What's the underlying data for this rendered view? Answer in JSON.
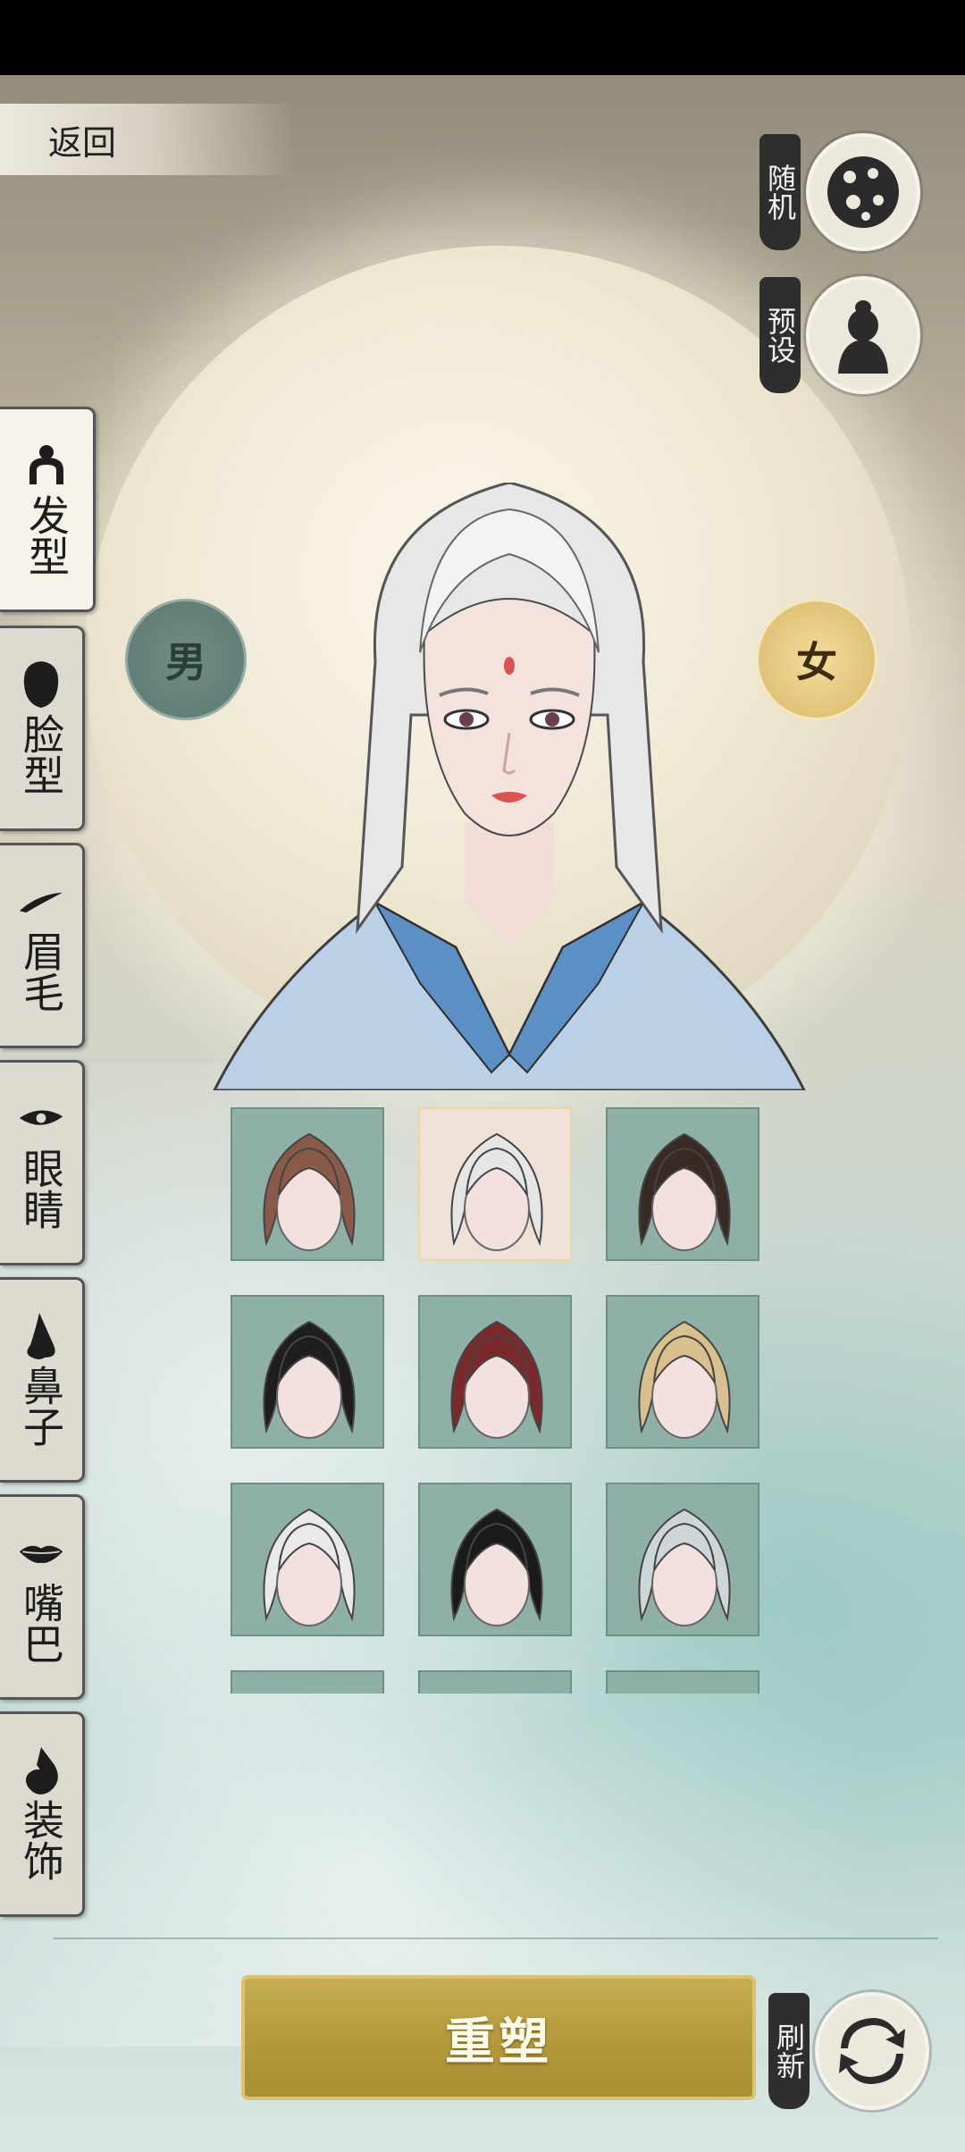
{
  "header": {
    "back_label": "返回"
  },
  "actions": {
    "random_label": "随机",
    "preset_label": "预设",
    "refresh_label": "刷新"
  },
  "gender": {
    "male_label": "男",
    "female_label": "女",
    "selected": "女"
  },
  "tabs": [
    {
      "label": "发型",
      "icon": "hair-bun-icon",
      "active": true
    },
    {
      "label": "脸型",
      "icon": "head-silhouette-icon",
      "active": false
    },
    {
      "label": "眉毛",
      "icon": "eyebrow-icon",
      "active": false
    },
    {
      "label": "眼睛",
      "icon": "eye-icon",
      "active": false
    },
    {
      "label": "鼻子",
      "icon": "nose-icon",
      "active": false
    },
    {
      "label": "嘴巴",
      "icon": "lips-icon",
      "active": false
    },
    {
      "label": "装饰",
      "icon": "ornament-icon",
      "active": false
    }
  ],
  "hairstyles": {
    "selected_index": 1,
    "items": [
      {
        "color": "#8a5a48"
      },
      {
        "color": "#e6e6e6"
      },
      {
        "color": "#3a2a24"
      },
      {
        "color": "#1f1d1d"
      },
      {
        "color": "#7a2a2a"
      },
      {
        "color": "#d9c08f"
      },
      {
        "color": "#e9e9e9"
      },
      {
        "color": "#1a1a1a"
      },
      {
        "color": "#cfd6da"
      },
      {
        "color": "#d8b47a"
      },
      {
        "color": "#2a1f1f"
      },
      {
        "color": "#8a5a48"
      }
    ]
  },
  "bottom": {
    "reshape_label": "重塑"
  },
  "colors": {
    "accent_gold": "#b59a3c",
    "panel_teal": "#8fb0a6",
    "moon": "#efe8d4"
  }
}
